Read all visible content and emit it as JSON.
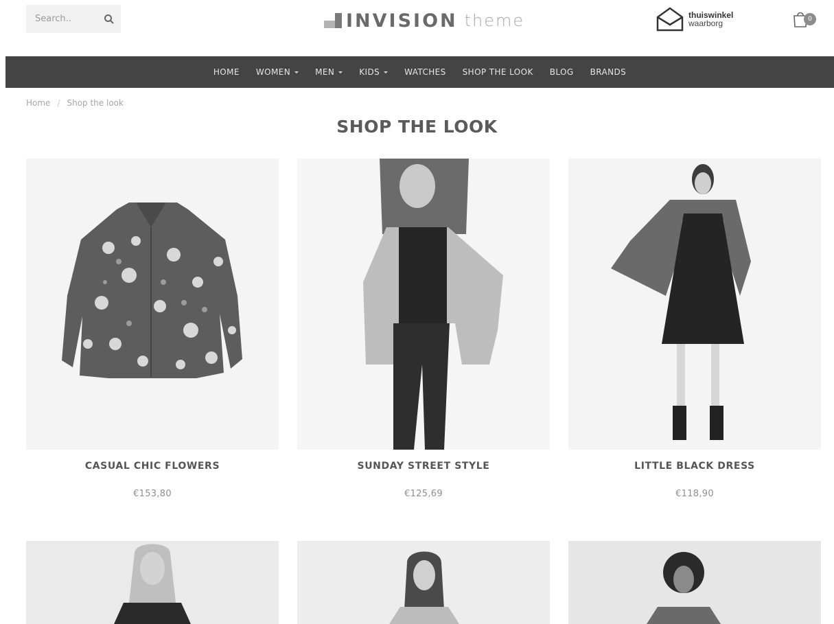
{
  "search": {
    "placeholder": "Search.."
  },
  "logo": {
    "brand": "INVISION",
    "sub": "theme"
  },
  "trust": {
    "line1": "thuiswinkel",
    "line2": "waarborg"
  },
  "cart": {
    "count": "0"
  },
  "nav": {
    "items": [
      {
        "label": "HOME"
      },
      {
        "label": "WOMEN"
      },
      {
        "label": "MEN"
      },
      {
        "label": "KIDS"
      },
      {
        "label": "WATCHES"
      },
      {
        "label": "SHOP THE LOOK"
      },
      {
        "label": "BLOG"
      },
      {
        "label": "BRANDS"
      }
    ]
  },
  "breadcrumb": {
    "home": "Home",
    "current": "Shop the look"
  },
  "page": {
    "title": "SHOP THE LOOK"
  },
  "products": [
    {
      "name": "CASUAL CHIC FLOWERS",
      "price": "€153,80"
    },
    {
      "name": "SUNDAY STREET STYLE",
      "price": "€125,69"
    },
    {
      "name": "LITTLE BLACK DRESS",
      "price": "€118,90"
    }
  ],
  "colors": {
    "nav_bg": "#444444",
    "title": "#5a5a5a",
    "price": "#8f8f8f"
  }
}
